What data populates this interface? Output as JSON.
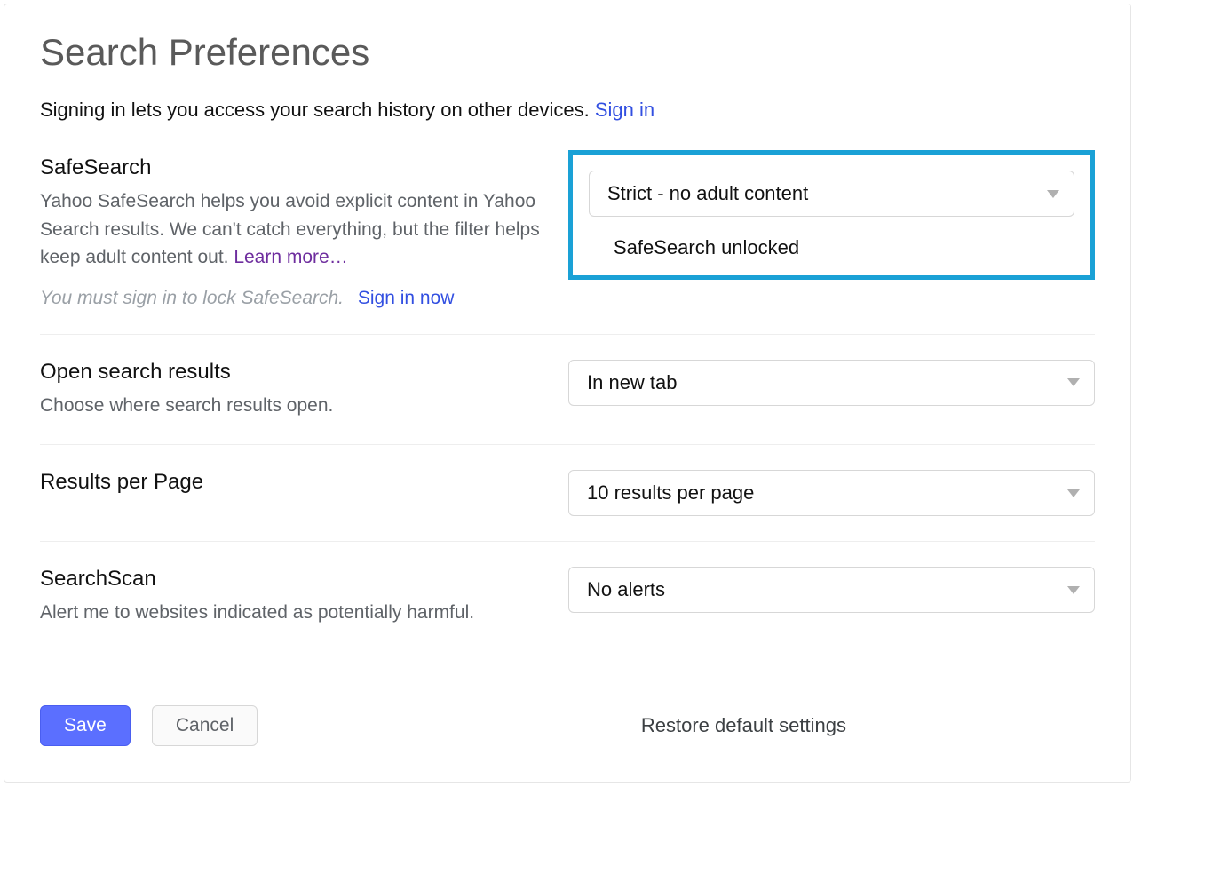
{
  "page": {
    "title": "Search Preferences",
    "signin_text": "Signing in lets you access your search history on other devices. ",
    "signin_link": "Sign in"
  },
  "safesearch": {
    "title": "SafeSearch",
    "desc": "Yahoo SafeSearch helps you avoid explicit content in Yahoo Search results. We can't catch everything, but the filter helps keep adult content out.  ",
    "learn_more": "Learn more…",
    "lock_note": "You must sign in to lock SafeSearch.",
    "signin_now": "Sign in now",
    "select_value": "Strict - no adult content",
    "status": "SafeSearch unlocked"
  },
  "open_results": {
    "title": "Open search results",
    "desc": "Choose where search results open.",
    "select_value": "In new tab"
  },
  "results_per_page": {
    "title": "Results per Page",
    "select_value": "10 results per page"
  },
  "searchscan": {
    "title": "SearchScan",
    "desc": "Alert me to websites indicated as potentially harmful.",
    "select_value": "No alerts"
  },
  "footer": {
    "save": "Save",
    "cancel": "Cancel",
    "restore": "Restore default settings"
  }
}
